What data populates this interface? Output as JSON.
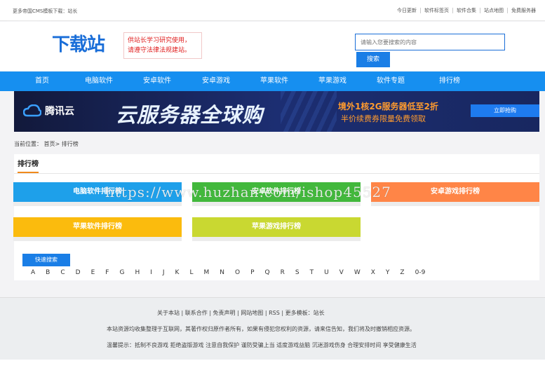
{
  "topbar": {
    "left_text": "更多帝国CMS模板下载：站长",
    "links": [
      "今日更新",
      "软件标签页",
      "软件合集",
      "站点地图",
      "免费服务器"
    ]
  },
  "header": {
    "logo_text": "下载站",
    "notice_line1": "供站长学习研究使用，",
    "notice_line2": "请遵守法律法规建站。",
    "search_placeholder": "请输入您要搜索的内容",
    "search_button": "搜索"
  },
  "nav": [
    "首页",
    "电脑软件",
    "安卓软件",
    "安卓游戏",
    "苹果软件",
    "苹果游戏",
    "软件专题",
    "排行榜"
  ],
  "banner": {
    "brand": "腾讯云",
    "headline": "云服务器全球购",
    "deal": "境外1核2G服务器低至2折",
    "sub": "半价续费券限量免费领取",
    "button": "立即抢购"
  },
  "breadcrumb": "当前位置： 首页> 排行榜",
  "panel": {
    "title": "排行榜",
    "tiles": [
      {
        "label": "电脑软件排行榜",
        "color": "#1ea0ea"
      },
      {
        "label": "安卓软件排行榜",
        "color": "#42b83c"
      },
      {
        "label": "安卓游戏排行榜",
        "color": "#ff8547"
      },
      {
        "label": "苹果软件排行榜",
        "color": "#fbbb0d"
      },
      {
        "label": "苹果游戏排行榜",
        "color": "#c9d831"
      }
    ],
    "quick_search": "快速搜索",
    "letters": [
      "A",
      "B",
      "C",
      "D",
      "E",
      "F",
      "G",
      "H",
      "I",
      "J",
      "K",
      "L",
      "M",
      "N",
      "O",
      "P",
      "Q",
      "R",
      "S",
      "T",
      "U",
      "V",
      "W",
      "X",
      "Y",
      "Z",
      "0-9"
    ]
  },
  "footer": {
    "line1": "关于本站 | 联系合作 | 免责声明 | 网站地图 | RSS | 更多模板：站长",
    "line2": "本站资源均收集整理于互联网，其著作权归原作者所有，如果有侵犯您权利的资源，请来信告知，我们将及时撤销相应资源。",
    "line3": "温馨提示：抵制不良游戏 拒绝盗版游戏 注意自我保护 谨防受骗上当 适度游戏益脑 沉迷游戏伤身 合理安排时间 享受健康生活"
  },
  "watermark": "https://www.huzhan.com/ishop45527",
  "colors": {
    "nav_bg": "#168ff0",
    "accent": "#1a7ee6",
    "tab_underline": "#f08a1c",
    "notice_text": "#e02020"
  }
}
